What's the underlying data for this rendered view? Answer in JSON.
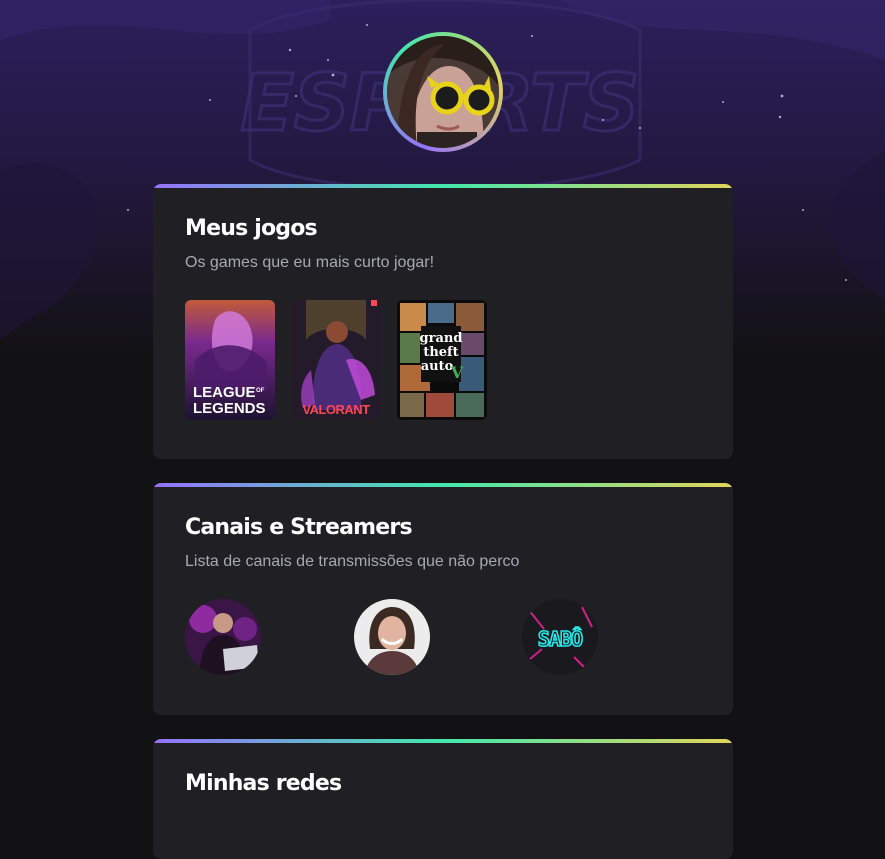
{
  "profile": {
    "avatar_alt": "Foto de perfil"
  },
  "background": {
    "logo_text": "ESPORTS"
  },
  "games_section": {
    "title": "Meus jogos",
    "subtitle": "Os games que eu mais curto jogar!",
    "games": [
      {
        "name": "League of Legends",
        "cover_line1": "LEAGUE",
        "cover_of": "OF",
        "cover_line2": "LEGENDS"
      },
      {
        "name": "Valorant",
        "cover_text": "VALORANT"
      },
      {
        "name": "Grand Theft Auto V",
        "cover_line1": "grand",
        "cover_line2": "theft",
        "cover_line3": "auto",
        "cover_numeral": "V"
      }
    ]
  },
  "channels_section": {
    "title": "Canais e Streamers",
    "subtitle": "Lista de canais de transmissões que não perco",
    "channels": [
      {
        "icon": "streamer-with-laptop-avatar"
      },
      {
        "icon": "smiling-woman-avatar"
      },
      {
        "icon": "neon-logo-avatar",
        "logo_text": "SABÔ"
      }
    ]
  },
  "networks_section": {
    "title": "Minhas redes"
  },
  "colors": {
    "page_bg": "#121214",
    "card_bg": "#202024",
    "subtitle": "#a8a8b3",
    "gradient_start": "#9572fc",
    "gradient_mid": "#43e7ad",
    "gradient_end": "#e2d45c"
  }
}
